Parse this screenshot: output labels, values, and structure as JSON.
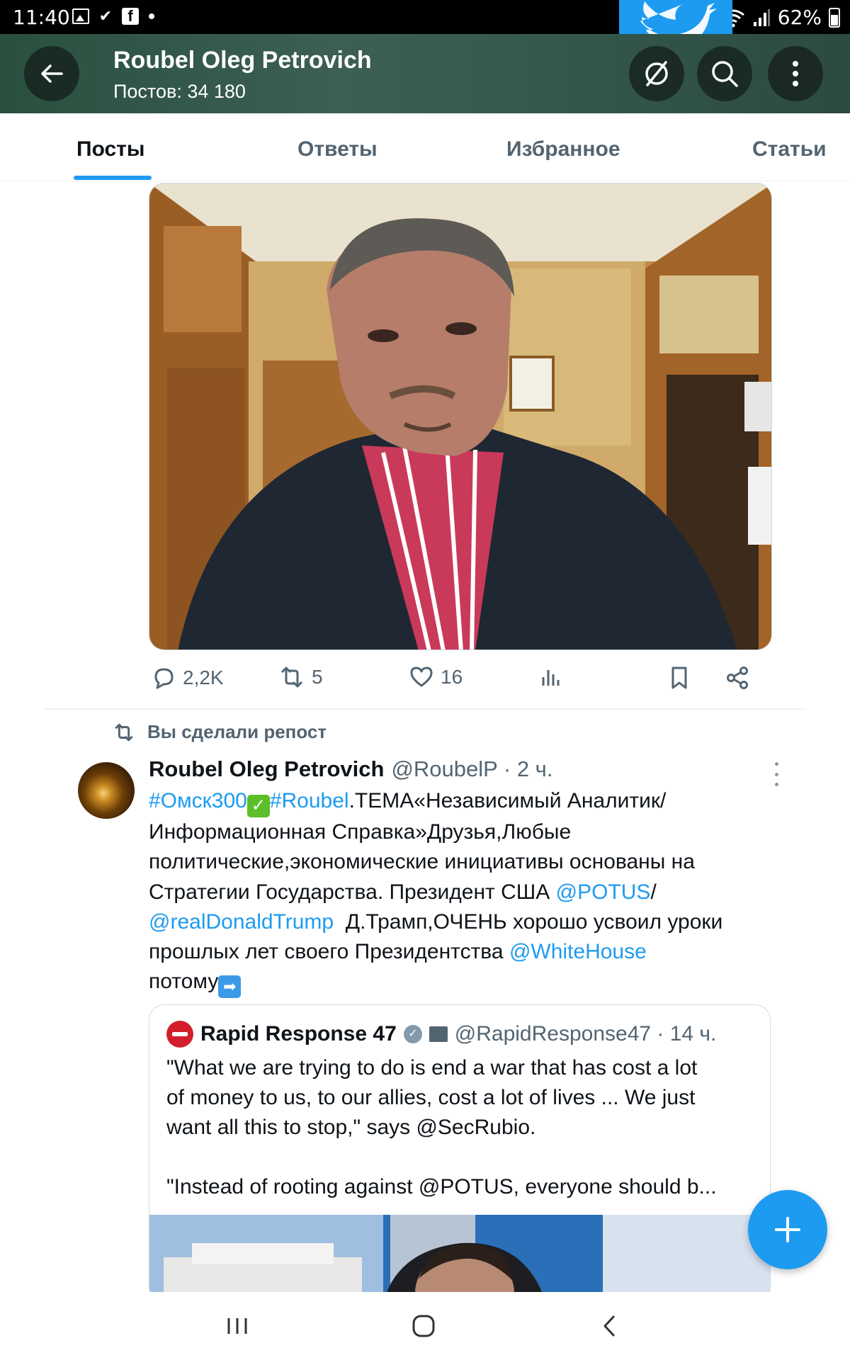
{
  "status_bar": {
    "time": "11:40",
    "battery": "62%",
    "icons": [
      "gallery-icon",
      "check-icon",
      "facebook-icon",
      "dot-icon",
      "wifi-icon",
      "signal-icon",
      "battery-icon"
    ]
  },
  "header": {
    "title": "Roubel Oleg Petrovich",
    "subtitle": "Постов: 34 180"
  },
  "tabs": [
    {
      "label": "Посты",
      "active": true
    },
    {
      "label": "Ответы",
      "active": false
    },
    {
      "label": "Избранное",
      "active": false
    },
    {
      "label": "Статьи",
      "active": false
    }
  ],
  "photo_post": {
    "stats": {
      "replies": "2,2K",
      "reposts": "5",
      "likes": "16"
    }
  },
  "repost_post": {
    "repost_label": "Вы сделали репост",
    "author_name": "Roubel Oleg Petrovich",
    "author_handle": "@RoubelP · 2 ч.",
    "text_lines": {
      "l1_tag1": "#Омск300",
      "l1_tag2": "#Roubel",
      "l1_rest": ".ТЕМА«Независимый Аналитик/",
      "l2": "Информационная Справка»Друзья,Любые",
      "l3": "политические,экономические инициативы основаны на",
      "l4_text": "Стратегии Государства. Президент США ",
      "l4_link": "@POTUS",
      "l4_end": "/",
      "l5_link": "@realDonaldTrump",
      "l5_text": "  Д.Трамп,ОЧЕНЬ хорошо усвоил уроки",
      "l6_text": "прошлых лет своего Президентства ",
      "l6_link": "@WhiteHouse",
      "l7_text": "потому"
    },
    "quote": {
      "author_name": "Rapid Response 47",
      "author_handle": "@RapidResponse47 · 14 ч.",
      "lines": [
        "\"What we are trying to do is end a war that has cost a lot",
        "of money to us, to our allies, cost a lot of lives ... We just",
        "want all this to stop,\" says @SecRubio.",
        "",
        "\"Instead of rooting against @POTUS, everyone should b..."
      ]
    }
  },
  "colors": {
    "accent": "#1d9bf0",
    "text_primary": "#0f1419",
    "text_secondary": "#536471",
    "header_bg": "#3d5f55"
  }
}
